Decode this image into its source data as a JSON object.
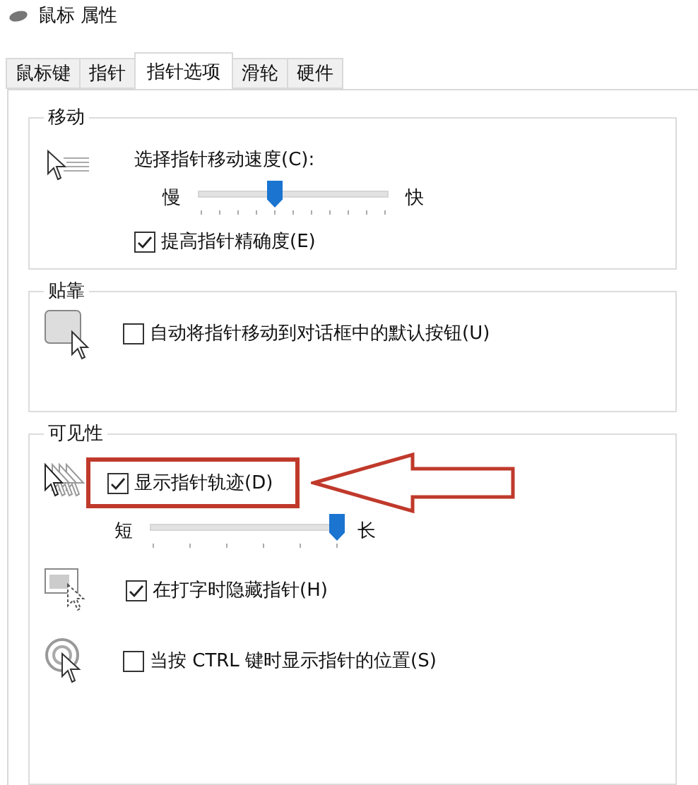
{
  "window": {
    "title": "鼠标 属性"
  },
  "tabs": [
    {
      "label": "鼠标键",
      "selected": false
    },
    {
      "label": "指针",
      "selected": false
    },
    {
      "label": "指针选项",
      "selected": true
    },
    {
      "label": "滑轮",
      "selected": false
    },
    {
      "label": "硬件",
      "selected": false
    }
  ],
  "motion": {
    "title": "移动",
    "speed_label": "选择指针移动速度(C):",
    "slider": {
      "min_label": "慢",
      "max_label": "快",
      "level": 0.4
    },
    "precision": {
      "label": "提高指针精确度(E)",
      "checked": true
    }
  },
  "snap": {
    "title": "贴靠",
    "snap_to": {
      "label": "自动将指针移动到对话框中的默认按钮(U)",
      "checked": false
    }
  },
  "visibility": {
    "title": "可见性",
    "trails": {
      "label": "显示指针轨迹(D)",
      "checked": true,
      "highlighted": true
    },
    "trail_length": {
      "min_label": "短",
      "max_label": "长",
      "level": 1
    },
    "hide_while_typing": {
      "label": "在打字时隐藏指针(H)",
      "checked": true
    },
    "show_location": {
      "label": "当按 CTRL 键时显示指针的位置(S)",
      "checked": false
    }
  }
}
